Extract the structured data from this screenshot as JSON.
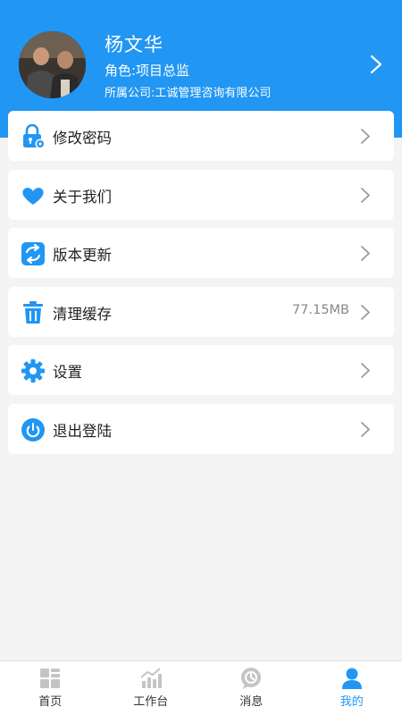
{
  "profile": {
    "name": "杨文华",
    "role": "角色:项目总监",
    "company": "所属公司:工诚管理咨询有限公司",
    "avatar_icon": "user-photo"
  },
  "menu": {
    "items": [
      {
        "label": "修改密码",
        "icon": "lock-gear-icon"
      },
      {
        "label": "关于我们",
        "icon": "heart-icon"
      },
      {
        "label": "版本更新",
        "icon": "refresh-icon"
      },
      {
        "label": "清理缓存",
        "icon": "trash-icon",
        "value": "77.15MB"
      },
      {
        "label": "设置",
        "icon": "gear-icon"
      },
      {
        "label": "退出登陆",
        "icon": "power-icon"
      }
    ]
  },
  "tabbar": {
    "tabs": [
      {
        "label": "首页",
        "icon": "grid-icon",
        "active": false
      },
      {
        "label": "工作台",
        "icon": "chart-icon",
        "active": false
      },
      {
        "label": "消息",
        "icon": "message-icon",
        "active": false
      },
      {
        "label": "我的",
        "icon": "person-icon",
        "active": true
      }
    ]
  },
  "colors": {
    "accent": "#2196f3",
    "background": "#f4f4f4",
    "card": "#ffffff",
    "tab_inactive": "#bdbdbd"
  }
}
